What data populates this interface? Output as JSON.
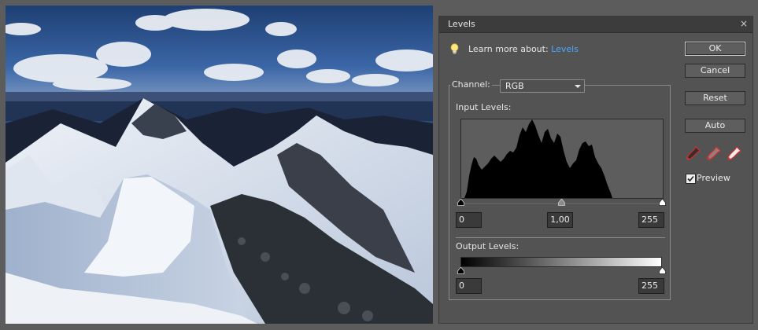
{
  "dialog": {
    "title": "Levels",
    "close_symbol": "×",
    "learn_more_prefix": "Learn more about:",
    "learn_more_link": "Levels",
    "channel_label": "Channel:",
    "channel_value": "RGB",
    "input_levels_label": "Input Levels:",
    "input_black": "0",
    "input_gamma": "1,00",
    "input_white": "255",
    "output_levels_label": "Output Levels:",
    "output_black": "0",
    "output_white": "255",
    "buttons": {
      "ok": "OK",
      "cancel": "Cancel",
      "reset": "Reset",
      "auto": "Auto"
    },
    "preview_label": "Preview",
    "preview_checked": true
  },
  "icons": {
    "tip": "lightbulb-icon",
    "close": "close-icon",
    "droppers": [
      "eyedropper-black-icon",
      "eyedropper-gray-icon",
      "eyedropper-white-icon"
    ],
    "slider_black": "slider-black-handle",
    "slider_gray": "slider-gray-handle",
    "slider_white": "slider-white-handle"
  },
  "colors": {
    "link": "#4aa8ff",
    "dialog_bg": "#535353",
    "titlebar_bg": "#3c3c3c",
    "histogram_fill": "#000000",
    "dropper_black": "#3a2a2a",
    "dropper_gray": "#9a7a7a",
    "dropper_white": "#f4eaea",
    "dropper_tip": "#d03030"
  }
}
